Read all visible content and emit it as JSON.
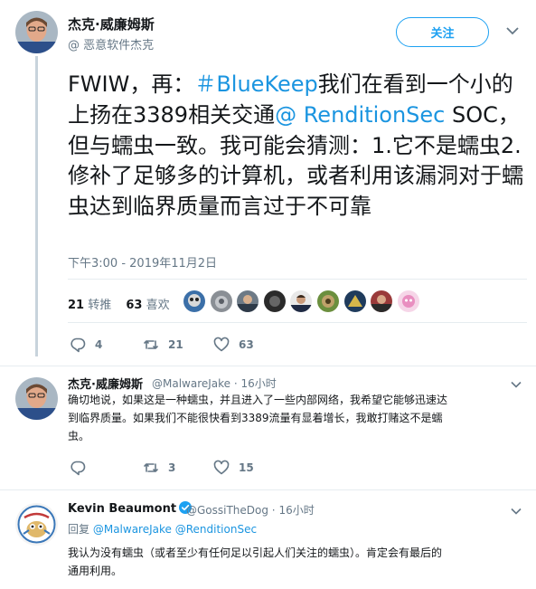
{
  "main_tweet": {
    "author_name": "杰克·威廉姆斯",
    "author_handle": "@ 恶意软件杰克",
    "follow_label": "关注",
    "text_parts": [
      {
        "text": "FWIW，再：",
        "link": false
      },
      {
        "text": "＃BlueKeep",
        "link": true
      },
      {
        "text": "我们在看到一个小的上扬在3389相关交通",
        "link": false
      },
      {
        "text": "@ RenditionSec",
        "link": true
      },
      {
        "text": " SOC，但与蠕虫一致。我可能会猜测：1.它不是蠕虫2.修补了足够多的计算机，或者利用该漏洞对于蠕虫达到临界质量而言过于不可靠",
        "link": false
      }
    ],
    "timestamp": "下午3:00 - 2019年11月2日",
    "retweets_count": "21",
    "retweets_label": "转推",
    "likes_count": "63",
    "likes_label": "喜欢",
    "liker_avatars": [
      "avatar-1",
      "avatar-2",
      "avatar-3",
      "avatar-4",
      "avatar-5",
      "avatar-6",
      "avatar-7",
      "avatar-8",
      "avatar-9"
    ],
    "actions": {
      "replies": "4",
      "retweets": "21",
      "likes": "63"
    }
  },
  "reply_1": {
    "author_name": "杰克·威廉姆斯",
    "meta": "@MalwareJake · 16小时",
    "body_lines": [
      "确切地说，如果这是一种蠕虫，并且进入了一些内部网络，我希望它能够迅速达",
      "到临界质量。如果我们不能很快看到3389流量有显着增长，我敢打赌这不是蠕",
      "虫。"
    ],
    "actions": {
      "replies": "",
      "retweets": "3",
      "likes": "15"
    }
  },
  "reply_2": {
    "author_name": "Kevin Beaumont",
    "meta": "@GossiTheDog · 16小时",
    "replying_prefix": "回复",
    "replying_to_1": "@MalwareJake",
    "replying_to_2": "@RenditionSec",
    "body_lines": [
      "我认为没有蠕虫（或者至少有任何足以引起人们关注的蠕虫）。肯定会有最后的",
      "通用利用。"
    ]
  },
  "colors": {
    "accent": "#1da1f2",
    "link": "#1b95e0",
    "muted": "#657786",
    "divider": "#e6ecf0",
    "thread_line": "#c8d3dc"
  }
}
